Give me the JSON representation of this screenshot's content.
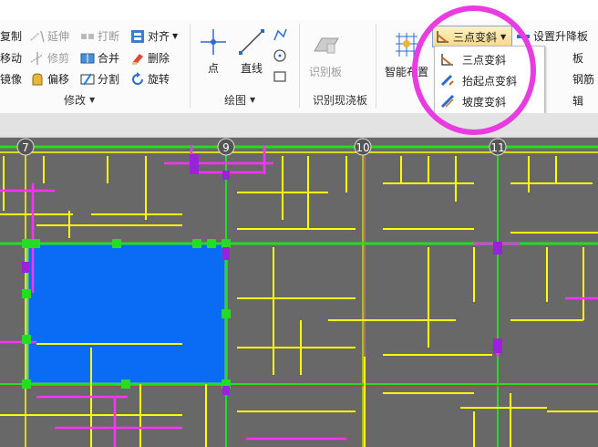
{
  "modify_group": {
    "label": "修改",
    "buttons": [
      {
        "text": "复制",
        "icon": "copy-icon",
        "enabled": true
      },
      {
        "text": "移动",
        "icon": "move-icon",
        "enabled": true
      },
      {
        "text": "镜像",
        "icon": "mirror-icon",
        "enabled": true
      },
      {
        "text": "延伸",
        "icon": "extend-icon",
        "enabled": false
      },
      {
        "text": "修剪",
        "icon": "trim-icon",
        "enabled": false
      },
      {
        "text": "偏移",
        "icon": "offset-icon",
        "enabled": true
      },
      {
        "text": "打断",
        "icon": "break-icon",
        "enabled": false
      },
      {
        "text": "合并",
        "icon": "merge-icon",
        "enabled": true
      },
      {
        "text": "分割",
        "icon": "split-icon",
        "enabled": true
      },
      {
        "text": "对齐",
        "icon": "align-icon",
        "enabled": true
      },
      {
        "text": "删除",
        "icon": "delete-icon",
        "enabled": true
      },
      {
        "text": "旋转",
        "icon": "rotate-icon",
        "enabled": true
      }
    ]
  },
  "draw_group": {
    "label": "绘图",
    "buttons": [
      {
        "text": "点",
        "icon": "point-icon"
      },
      {
        "text": "直线",
        "icon": "line-icon"
      }
    ]
  },
  "recognize_group": {
    "label": "识别现浇板",
    "buttons": [
      {
        "text": "识别板",
        "icon": "recognize-slab-icon",
        "enabled": false
      }
    ]
  },
  "layout_group": {
    "smart_layout": {
      "text": "智能布置",
      "icon": "smart-layout-icon"
    },
    "slope_dropdown": {
      "text": "三点变斜",
      "icon": "three-point-slope-icon"
    },
    "set_raise_lower": {
      "text": "设置升降板",
      "icon": "raise-lower-icon"
    },
    "partial_labels": [
      "板",
      "钢筋",
      "辑"
    ]
  },
  "slope_menu": {
    "items": [
      {
        "text": "三点变斜",
        "icon": "three-point-slope-icon"
      },
      {
        "text": "抬起点变斜",
        "icon": "lift-point-slope-icon"
      },
      {
        "text": "坡度变斜",
        "icon": "gradient-slope-icon"
      }
    ]
  },
  "canvas": {
    "axes": [
      "7",
      "9",
      "10",
      "11"
    ],
    "selected_slab_color": "#0a6cf5"
  },
  "colors": {
    "wall_yellow": "#ffff00",
    "beam_magenta": "#ff33ff",
    "green": "#22dd22",
    "highlight": "#e83be0"
  }
}
